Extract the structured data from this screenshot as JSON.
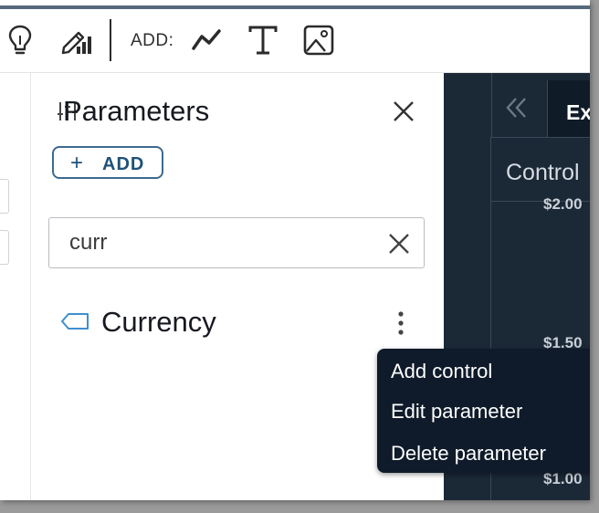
{
  "toolbar": {
    "add_label": "ADD:",
    "icons": [
      "lightbulb-icon",
      "edit-visual-icon",
      "line-chart-icon",
      "text-icon",
      "image-icon"
    ]
  },
  "parameters_panel": {
    "title": "Parameters",
    "add_button_label": "ADD",
    "search": {
      "value": "curr"
    },
    "results": [
      {
        "name": "Currency"
      }
    ]
  },
  "right_panel": {
    "tab_label": "Ex",
    "controls_label": "Control",
    "y_ticks": [
      "$2.00",
      "$1.50",
      "$1.00"
    ]
  },
  "context_menu": {
    "items": [
      "Add control",
      "Edit parameter",
      "Delete parameter"
    ]
  },
  "colors": {
    "accent": "#1f5279",
    "dark_bg": "#1b2836",
    "menu_bg": "#0f1b2a",
    "param_icon": "#3f8fd0"
  }
}
